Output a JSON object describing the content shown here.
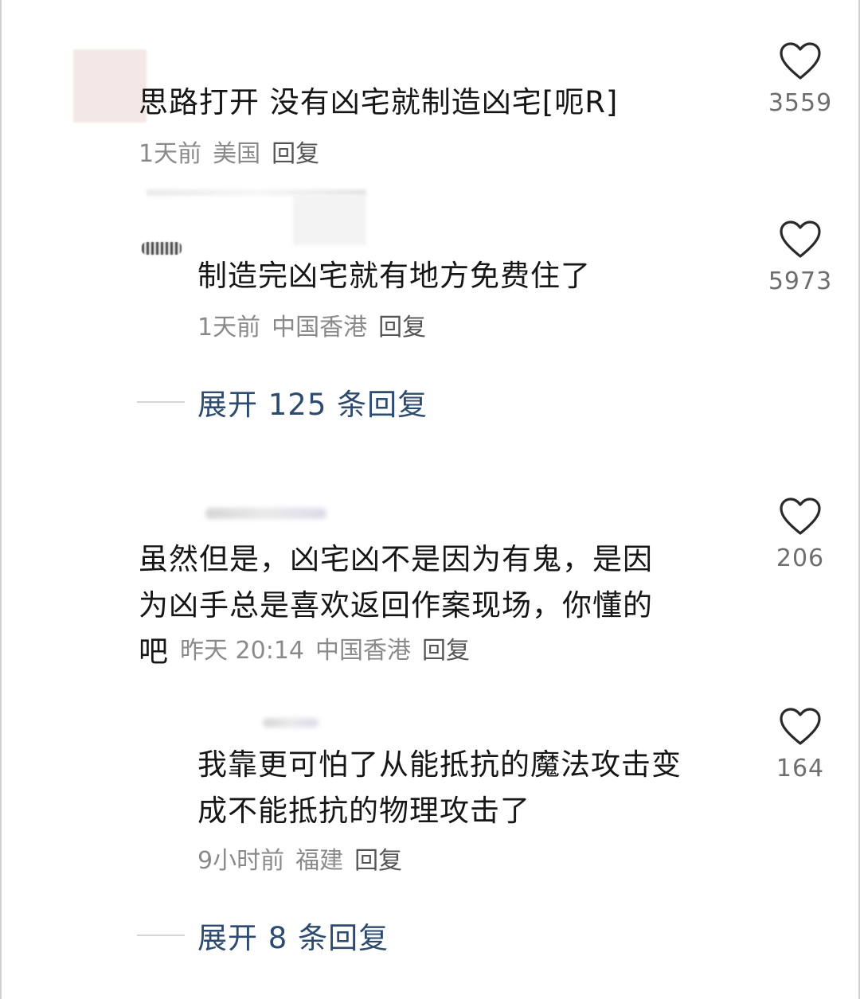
{
  "comments": [
    {
      "text": "思路打开 没有凶宅就制造凶宅[呃R]",
      "time": "1天前",
      "location": "美国",
      "reply": "回复",
      "likes": "3559"
    },
    {
      "text": "制造完凶宅就有地方免费住了",
      "time": "1天前",
      "location": "中国香港",
      "reply": "回复",
      "likes": "5973"
    },
    {
      "text_line1": "虽然但是，凶宅凶不是因为有鬼，是因",
      "text_line2": "为凶手总是喜欢返回作案现场，你懂的",
      "text_line3": "吧",
      "time": "昨天 20:14",
      "location": "中国香港",
      "reply": "回复",
      "likes": "206"
    },
    {
      "text_line1": "我靠更可怕了从能抵抗的魔法攻击变",
      "text_line2": "成不能抵抗的物理攻击了",
      "time": "9小时前",
      "location": "福建",
      "reply": "回复",
      "likes": "164"
    }
  ],
  "expand": [
    {
      "label": "展开 125 条回复"
    },
    {
      "label": "展开 8 条回复"
    }
  ],
  "icons": {
    "like": "heart-outline-icon"
  },
  "colors": {
    "expand_text": "#2d4a6f",
    "meta_text": "#8a8a8a",
    "body_text": "#161616"
  }
}
